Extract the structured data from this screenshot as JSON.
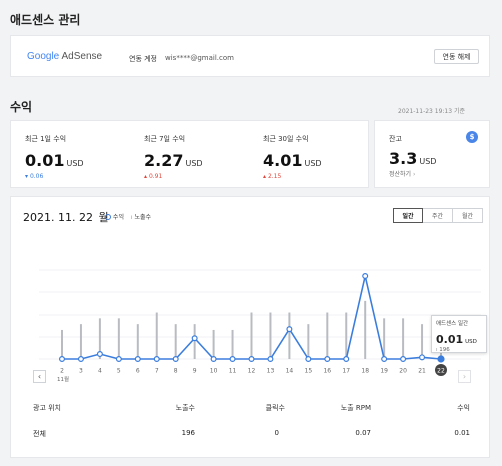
{
  "header": {
    "title": "애드센스 관리"
  },
  "account": {
    "logo_google": "Google",
    "logo_adsense": " AdSense",
    "label": "연동 계정",
    "email": "wis****@gmail.com",
    "unlink_button": "연동 해제"
  },
  "revenue": {
    "title": "수익",
    "timestamp": "2021-11-23 19:13 기준",
    "stats": [
      {
        "label": "최근 1일 수익",
        "value": "0.01",
        "unit": "USD",
        "delta": "0.06",
        "arrow": "▾",
        "color": "#3b7ddd"
      },
      {
        "label": "최근 7일 수익",
        "value": "2.27",
        "unit": "USD",
        "delta": "0.91",
        "arrow": "▴",
        "color": "#e3463b"
      },
      {
        "label": "최근 30일 수익",
        "value": "4.01",
        "unit": "USD",
        "delta": "2.15",
        "arrow": "▴",
        "color": "#e3463b"
      }
    ],
    "balance": {
      "label": "잔고",
      "value": "3.3",
      "unit": "USD",
      "link": "정산하기",
      "icon_text": "$"
    }
  },
  "chart_panel": {
    "date": "2021. 11. 22",
    "day": "월",
    "legend": [
      {
        "label": "수익",
        "symbol": "○"
      },
      {
        "label": "노출수",
        "symbol": "ı"
      }
    ],
    "tabs": [
      "일간",
      "주간",
      "월간"
    ],
    "active_tab": 0,
    "month_label": "11월",
    "tooltip": {
      "title": "애드센스 일간",
      "value": "0.01",
      "unit": "USD",
      "sub": "196"
    }
  },
  "chart_data": {
    "type": "line",
    "x": [
      2,
      3,
      4,
      5,
      6,
      7,
      8,
      9,
      10,
      11,
      12,
      13,
      14,
      15,
      16,
      17,
      18,
      19,
      20,
      21,
      22
    ],
    "series": [
      {
        "name": "수익",
        "values": [
          0.0,
          0.0,
          0.06,
          0.0,
          0.0,
          0.0,
          0.0,
          0.25,
          0.0,
          0.0,
          0.0,
          0.0,
          0.36,
          0.0,
          0.0,
          0.0,
          1.0,
          0.0,
          0.0,
          0.02,
          0.0
        ]
      },
      {
        "name": "노출수",
        "values": [
          0.35,
          0.42,
          0.49,
          0.49,
          0.42,
          0.56,
          0.42,
          0.42,
          0.35,
          0.35,
          0.56,
          0.56,
          0.56,
          0.42,
          0.56,
          0.56,
          0.7,
          0.49,
          0.49,
          0.42,
          0.1
        ]
      }
    ],
    "selected_index": 20,
    "ylim": [
      0,
      1
    ]
  },
  "table": {
    "headers": [
      "광고 위치",
      "노출수",
      "클릭수",
      "노출 RPM",
      "수익"
    ],
    "rows": [
      [
        "전체",
        "196",
        "0",
        "0.07",
        "0.01"
      ]
    ]
  }
}
